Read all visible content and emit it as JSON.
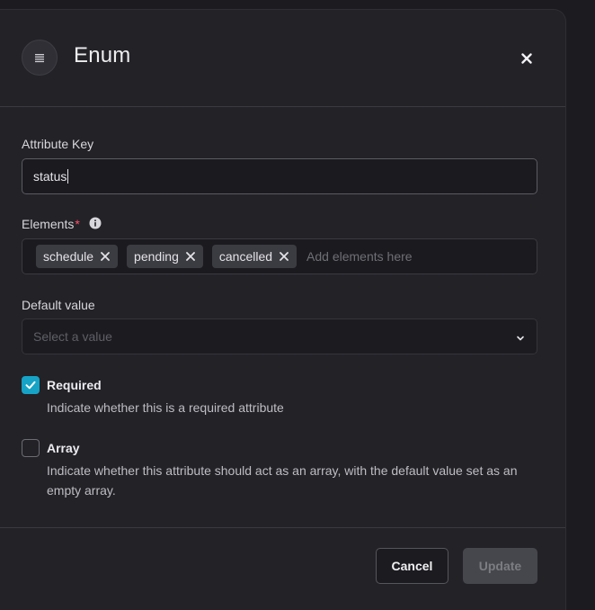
{
  "modal": {
    "title": "Enum",
    "icon": "list-icon",
    "close_icon": "close-icon"
  },
  "attribute_key": {
    "label": "Attribute Key",
    "value": "status"
  },
  "elements": {
    "label": "Elements",
    "required_marker": "*",
    "info_icon": "info-icon",
    "tags": [
      "schedule",
      "pending",
      "cancelled"
    ],
    "placeholder": "Add elements here"
  },
  "default_value": {
    "label": "Default value",
    "placeholder": "Select a value",
    "icon": "chevron-down-icon"
  },
  "options": {
    "required": {
      "checked": true,
      "title": "Required",
      "description": "Indicate whether this is a required attribute"
    },
    "array": {
      "checked": false,
      "title": "Array",
      "description": "Indicate whether this attribute should act as an array, with the default value set as an empty array."
    }
  },
  "footer": {
    "cancel_label": "Cancel",
    "update_label": "Update"
  },
  "colors": {
    "accent": "#16a3c6",
    "required_star": "#ff5068",
    "background": "#222227"
  }
}
